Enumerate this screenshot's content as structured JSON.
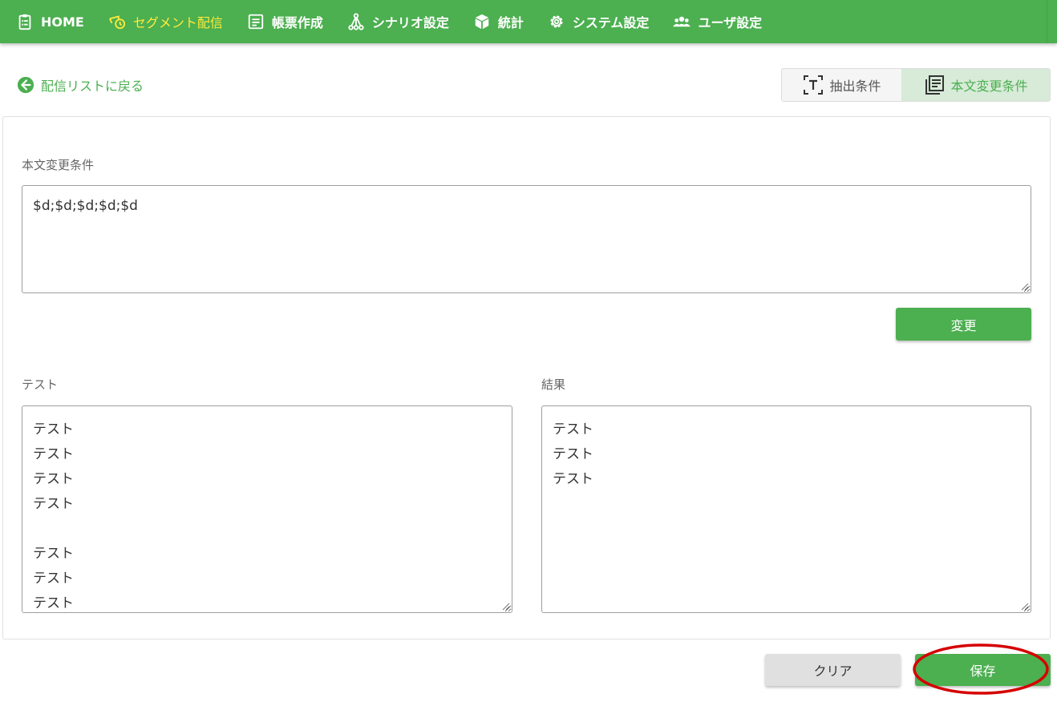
{
  "nav": {
    "items": [
      {
        "label": "HOME",
        "icon": "clipboard-icon"
      },
      {
        "label": "セグメント配信",
        "icon": "megaphone-clock-icon"
      },
      {
        "label": "帳票作成",
        "icon": "document-icon"
      },
      {
        "label": "シナリオ設定",
        "icon": "flow-icon"
      },
      {
        "label": "統計",
        "icon": "cube-icon"
      },
      {
        "label": "システム設定",
        "icon": "gear-icon"
      },
      {
        "label": "ユーザ設定",
        "icon": "users-icon"
      }
    ],
    "active_index": 1
  },
  "back_link": {
    "label": "配信リストに戻る",
    "icon": "arrow-left-circle-icon"
  },
  "toggle": {
    "extract_label": "抽出条件",
    "body_change_label": "本文変更条件",
    "selected": "body_change"
  },
  "body_condition": {
    "label": "本文変更条件",
    "value": "$d;$d;$d;$d;$d"
  },
  "change_button_label": "変更",
  "test": {
    "label": "テスト",
    "lines": [
      "テスト",
      "テスト",
      "テスト",
      "テスト",
      "",
      "テスト",
      "テスト",
      "テスト"
    ]
  },
  "result": {
    "label": "結果",
    "lines": [
      "テスト",
      "テスト",
      "テスト"
    ]
  },
  "clear_button_label": "クリア",
  "save_button_label": "保存",
  "colors": {
    "primary": "#4caf50",
    "active_nav": "#ffeb3b",
    "annotation": "#d50000"
  }
}
